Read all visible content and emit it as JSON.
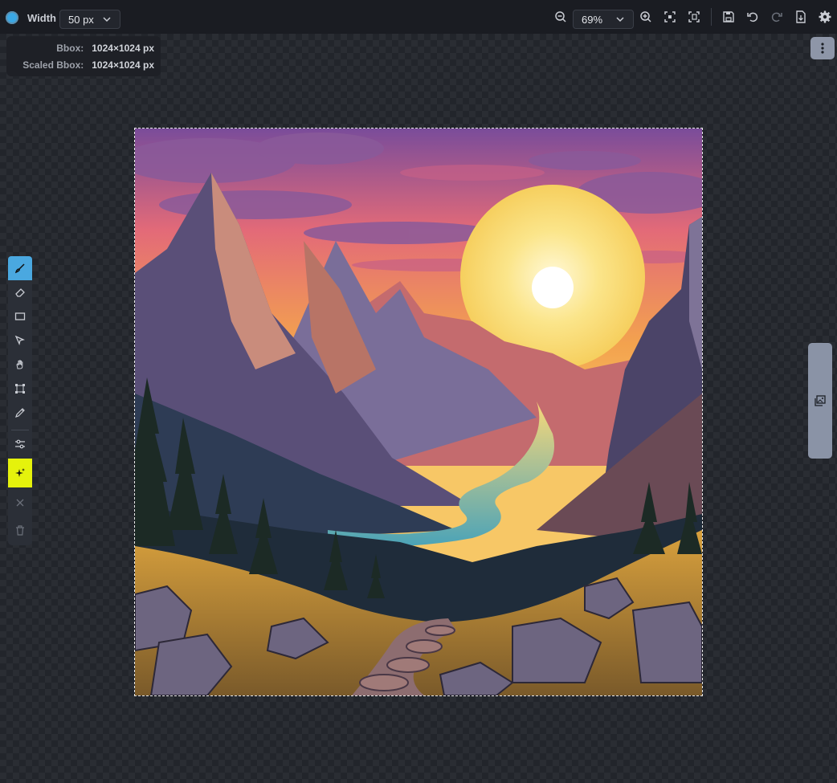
{
  "toolbar": {
    "brush_color": "#3aa7e4",
    "width_label": "Width",
    "width_value": "50 px",
    "zoom_value": "69%",
    "icons": [
      "zoom-out-icon",
      "zoom-in-icon",
      "fit-icon",
      "fit-bbox-icon",
      "save-icon",
      "undo-icon",
      "redo-icon",
      "export-icon",
      "settings-icon"
    ]
  },
  "bbox_panel": {
    "bbox_label": "Bbox:",
    "bbox_value": "1024×1024 px",
    "scaled_label": "Scaled Bbox:",
    "scaled_value": "1024×1024 px"
  },
  "tools": {
    "items": [
      "brush-icon",
      "eraser-icon",
      "rectangle-icon",
      "move-icon",
      "hand-icon",
      "transform-icon",
      "color-picker-icon",
      "adjust-icon",
      "magic-icon",
      "close-icon",
      "trash-icon"
    ],
    "active": "brush-icon",
    "accent": "#4aa8e0",
    "magic_color": "#e5f20c"
  },
  "canvas": {
    "image_subject": "sunset mountain valley with river and stone path"
  }
}
